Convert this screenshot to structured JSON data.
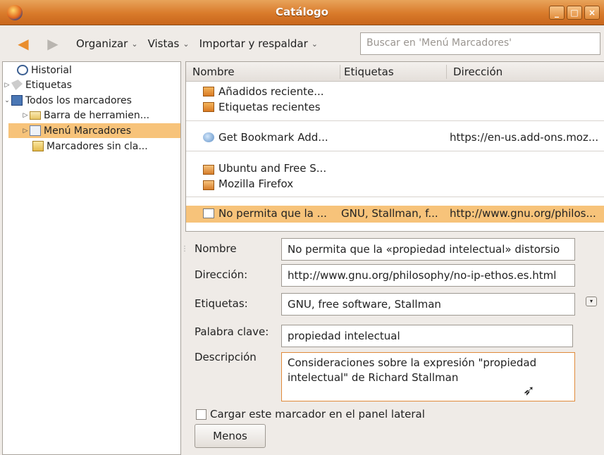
{
  "window": {
    "title": "Catálogo",
    "controls": [
      "_",
      "□",
      "×"
    ]
  },
  "toolbar": {
    "organize": "Organizar",
    "views": "Vistas",
    "import_backup": "Importar y respaldar",
    "search_placeholder": "Buscar en 'Menú Marcadores'"
  },
  "tree": {
    "items": [
      {
        "label": "Historial"
      },
      {
        "label": "Etiquetas"
      },
      {
        "label": "Todos los marcadores"
      },
      {
        "label": "Barra de herramien..."
      },
      {
        "label": "Menú Marcadores"
      },
      {
        "label": "Marcadores sin cla..."
      }
    ],
    "selected": "Menú Marcadores"
  },
  "list": {
    "columns": [
      "Nombre",
      "Etiquetas",
      "Dirección"
    ],
    "rows": [
      {
        "name": "Añadidos reciente...",
        "tags": "",
        "address": ""
      },
      {
        "name": "Etiquetas recientes",
        "tags": "",
        "address": ""
      },
      {
        "name": "Get Bookmark Add...",
        "tags": "",
        "address": "https://en-us.add-ons.moz..."
      },
      {
        "name": "Ubuntu and Free S...",
        "tags": "",
        "address": ""
      },
      {
        "name": "Mozilla Firefox",
        "tags": "",
        "address": ""
      },
      {
        "name": "No permita que la ...",
        "tags": "GNU, Stallman, f...",
        "address": "http://www.gnu.org/philos..."
      }
    ]
  },
  "details": {
    "name_label": "Nombre",
    "name_value": "No permita que la «propiedad intelectual» distorsio",
    "address_label": "Dirección:",
    "address_value": "http://www.gnu.org/philosophy/no-ip-ethos.es.html",
    "tags_label": "Etiquetas:",
    "tags_value": "GNU, free software, Stallman",
    "keyword_label": "Palabra clave:",
    "keyword_value": "propiedad intelectual",
    "description_label": "Descripción",
    "description_value": "Consideraciones sobre la expresión \"propiedad intelectual\" de Richard Stallman",
    "sidebar_checkbox_label": "Cargar este marcador en el panel lateral",
    "less_button": "Menos"
  },
  "colors": {
    "titlebar": "#d97a2a",
    "selection": "#f7c37a",
    "focus": "#e08a3a"
  }
}
